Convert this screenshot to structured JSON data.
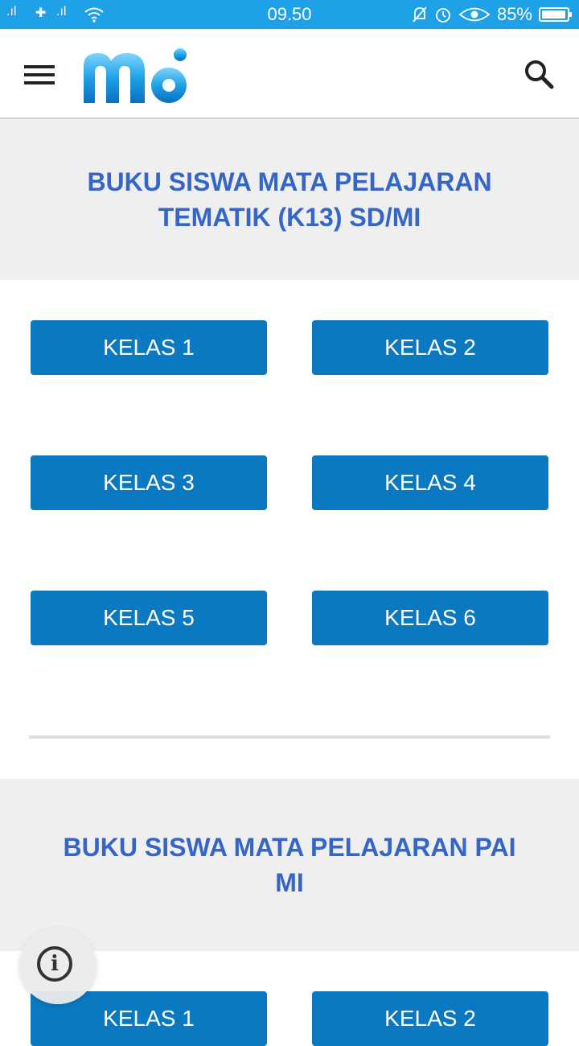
{
  "status_bar": {
    "time": "09.50",
    "battery": "85%",
    "battery_level": 0.85
  },
  "app_bar": {
    "logo_alt": "mb logo",
    "menu_icon": "hamburger-icon",
    "search_icon": "search-icon"
  },
  "sections": [
    {
      "title": "BUKU SISWA MATA PELAJARAN TEMATIK (K13) SD/MI",
      "buttons": [
        "KELAS 1",
        "KELAS 2",
        "KELAS 3",
        "KELAS 4",
        "KELAS 5",
        "KELAS 6"
      ]
    },
    {
      "title": "BUKU SISWA MATA PELAJARAN PAI MI",
      "buttons": [
        "KELAS 1",
        "KELAS 2"
      ]
    }
  ],
  "colors": {
    "status_bar": "#1ea1e6",
    "title_blue": "#3465c7",
    "button_blue": "#0a79c2",
    "section_bg": "#efeff0"
  }
}
